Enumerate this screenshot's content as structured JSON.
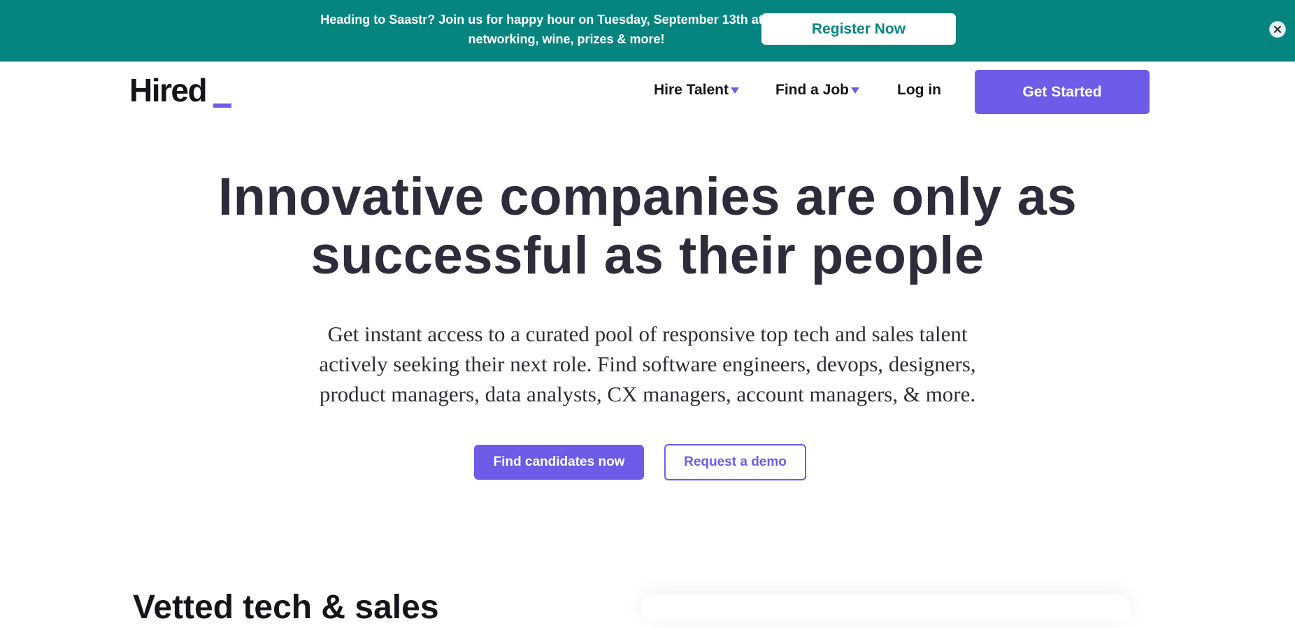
{
  "banner": {
    "text": "Heading to Saastr? Join us for happy hour on Tuesday, September 13th at 6pm for networking, wine, prizes & more!",
    "button_label": "Register Now",
    "close_icon": "close-icon",
    "background_color": "#068580"
  },
  "header": {
    "logo_text": "Hired",
    "nav": {
      "hire_talent": "Hire Talent",
      "find_job": "Find a Job",
      "login": "Log in"
    },
    "get_started_label": "Get Started",
    "accent_color": "#6c5ce7"
  },
  "hero": {
    "title": "Innovative companies are only as successful as their people",
    "subtitle": "Get instant access to a curated pool of responsive top tech and sales talent actively seeking their next role. Find software engineers, devops, designers, product managers, data analysts, CX managers, account managers, & more.",
    "primary_cta": "Find candidates now",
    "secondary_cta": "Request a demo"
  },
  "next_section": {
    "heading": "Vetted tech & sales"
  }
}
